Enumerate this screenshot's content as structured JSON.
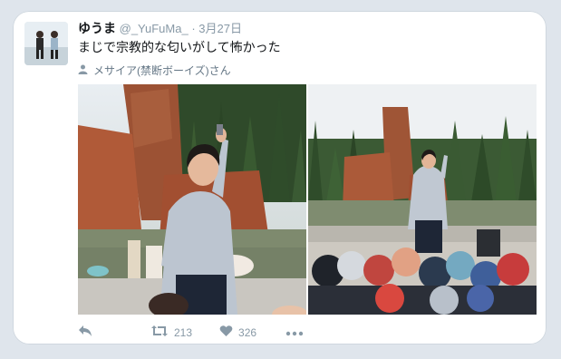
{
  "tweet": {
    "display_name": "ゆうま",
    "handle": "@_YuFuMa_",
    "separator": "·",
    "date": "3月27日",
    "text": "まじで宗教的な匂いがして怖かった",
    "mention": "メサイア(禁断ボーイズ)さん",
    "mention_icon": "person-icon"
  },
  "actions": {
    "reply_icon": "reply-icon",
    "retweet_icon": "retweet-icon",
    "retweet_count": "213",
    "like_icon": "heart-icon",
    "like_count": "326",
    "more_icon": "more-icon"
  },
  "colors": {
    "background": "#dfe5ec",
    "card": "#ffffff",
    "text": "#14171a",
    "muted": "#8899a6"
  }
}
